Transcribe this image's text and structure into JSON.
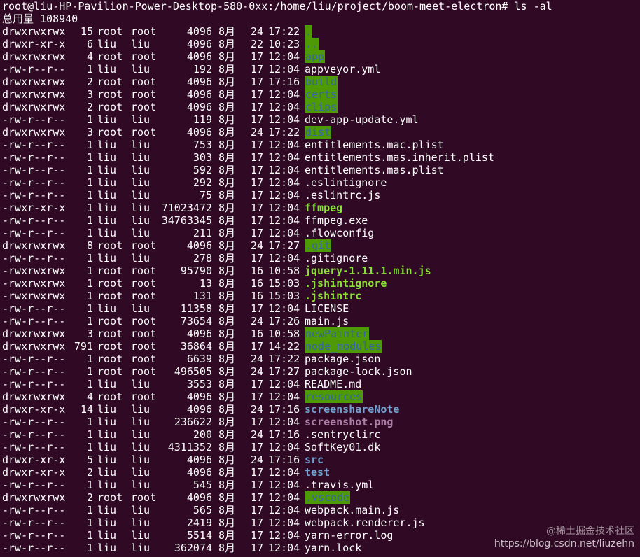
{
  "terminal": {
    "prompt": "root@liu-HP-Pavilion-Power-Desktop-580-0xx:/home/liu/project/boom-meet-electron# ls -al",
    "total": "总用量 108940",
    "rows": [
      [
        "drwxrwxrwx",
        "15",
        "root",
        "root",
        "4096",
        "8月",
        "24",
        "17:22",
        ".",
        "dirbg"
      ],
      [
        "drwxr-xr-x",
        "6",
        "liu",
        "liu",
        "4096",
        "8月",
        "22",
        "10:23",
        "..",
        "dirbg"
      ],
      [
        "drwxrwxrwx",
        "4",
        "root",
        "root",
        "4096",
        "8月",
        "17",
        "12:04",
        "app",
        "dirbg"
      ],
      [
        "-rw-r--r--",
        "1",
        "liu",
        "liu",
        "192",
        "8月",
        "17",
        "12:04",
        "appveyor.yml",
        "file"
      ],
      [
        "drwxrwxrwx",
        "2",
        "root",
        "root",
        "4096",
        "8月",
        "17",
        "17:16",
        "build",
        "dirbg"
      ],
      [
        "drwxrwxrwx",
        "3",
        "root",
        "root",
        "4096",
        "8月",
        "17",
        "12:04",
        "certs",
        "dirbg"
      ],
      [
        "drwxrwxrwx",
        "2",
        "root",
        "root",
        "4096",
        "8月",
        "17",
        "12:04",
        "clips",
        "dirbg"
      ],
      [
        "-rw-r--r--",
        "1",
        "liu",
        "liu",
        "119",
        "8月",
        "17",
        "12:04",
        "dev-app-update.yml",
        "file"
      ],
      [
        "drwxrwxrwx",
        "3",
        "root",
        "root",
        "4096",
        "8月",
        "24",
        "17:22",
        "dist",
        "dirbg"
      ],
      [
        "-rw-r--r--",
        "1",
        "liu",
        "liu",
        "753",
        "8月",
        "17",
        "12:04",
        "entitlements.mac.plist",
        "file"
      ],
      [
        "-rw-r--r--",
        "1",
        "liu",
        "liu",
        "303",
        "8月",
        "17",
        "12:04",
        "entitlements.mas.inherit.plist",
        "file"
      ],
      [
        "-rw-r--r--",
        "1",
        "liu",
        "liu",
        "592",
        "8月",
        "17",
        "12:04",
        "entitlements.mas.plist",
        "file"
      ],
      [
        "-rw-r--r--",
        "1",
        "liu",
        "liu",
        "292",
        "8月",
        "17",
        "12:04",
        ".eslintignore",
        "file"
      ],
      [
        "-rw-r--r--",
        "1",
        "liu",
        "liu",
        "75",
        "8月",
        "17",
        "12:04",
        ".eslintrc.js",
        "file"
      ],
      [
        "-rwxr-xr-x",
        "1",
        "liu",
        "liu",
        "71023472",
        "8月",
        "17",
        "12:04",
        "ffmpeg",
        "exec"
      ],
      [
        "-rw-r--r--",
        "1",
        "liu",
        "liu",
        "34763345",
        "8月",
        "17",
        "12:04",
        "ffmpeg.exe",
        "file"
      ],
      [
        "-rw-r--r--",
        "1",
        "liu",
        "liu",
        "211",
        "8月",
        "17",
        "12:04",
        ".flowconfig",
        "file"
      ],
      [
        "drwxrwxrwx",
        "8",
        "root",
        "root",
        "4096",
        "8月",
        "24",
        "17:27",
        ".git",
        "dirbg"
      ],
      [
        "-rw-r--r--",
        "1",
        "liu",
        "liu",
        "278",
        "8月",
        "17",
        "12:04",
        ".gitignore",
        "file"
      ],
      [
        "-rwxrwxrwx",
        "1",
        "root",
        "root",
        "95790",
        "8月",
        "16",
        "10:58",
        "jquery-1.11.1.min.js",
        "exec"
      ],
      [
        "-rwxrwxrwx",
        "1",
        "root",
        "root",
        "13",
        "8月",
        "16",
        "15:03",
        ".jshintignore",
        "exec"
      ],
      [
        "-rwxrwxrwx",
        "1",
        "root",
        "root",
        "131",
        "8月",
        "16",
        "15:03",
        ".jshintrc",
        "exec"
      ],
      [
        "-rw-r--r--",
        "1",
        "liu",
        "liu",
        "11358",
        "8月",
        "17",
        "12:04",
        "LICENSE",
        "file"
      ],
      [
        "-rw-r--r--",
        "1",
        "root",
        "root",
        "73654",
        "8月",
        "24",
        "17:26",
        "main.js",
        "file"
      ],
      [
        "drwxrwxrwx",
        "3",
        "root",
        "root",
        "4096",
        "8月",
        "16",
        "10:58",
        "newPainter",
        "dirbg"
      ],
      [
        "drwxrwxrwx",
        "791",
        "root",
        "root",
        "36864",
        "8月",
        "17",
        "14:22",
        "node_modules",
        "dirbg"
      ],
      [
        "-rw-r--r--",
        "1",
        "root",
        "root",
        "6639",
        "8月",
        "24",
        "17:22",
        "package.json",
        "file"
      ],
      [
        "-rw-r--r--",
        "1",
        "root",
        "root",
        "496505",
        "8月",
        "24",
        "17:27",
        "package-lock.json",
        "file"
      ],
      [
        "-rw-r--r--",
        "1",
        "liu",
        "liu",
        "3553",
        "8月",
        "17",
        "12:04",
        "README.md",
        "file"
      ],
      [
        "drwxrwxrwx",
        "4",
        "root",
        "root",
        "4096",
        "8月",
        "17",
        "12:04",
        "resources",
        "dirbg"
      ],
      [
        "drwxr-xr-x",
        "14",
        "liu",
        "liu",
        "4096",
        "8月",
        "24",
        "17:16",
        "screenshareNote",
        "dir"
      ],
      [
        "-rw-r--r--",
        "1",
        "liu",
        "liu",
        "236622",
        "8月",
        "17",
        "12:04",
        "screenshot.png",
        "image"
      ],
      [
        "-rw-r--r--",
        "1",
        "liu",
        "liu",
        "200",
        "8月",
        "24",
        "17:16",
        ".sentryclirc",
        "file"
      ],
      [
        "-rw-r--r--",
        "1",
        "liu",
        "liu",
        "4311352",
        "8月",
        "17",
        "12:04",
        "SoftKey01.dk",
        "file"
      ],
      [
        "drwxr-xr-x",
        "5",
        "liu",
        "liu",
        "4096",
        "8月",
        "24",
        "17:16",
        "src",
        "dir"
      ],
      [
        "drwxr-xr-x",
        "2",
        "liu",
        "liu",
        "4096",
        "8月",
        "17",
        "12:04",
        "test",
        "dir"
      ],
      [
        "-rw-r--r--",
        "1",
        "liu",
        "liu",
        "545",
        "8月",
        "17",
        "12:04",
        ".travis.yml",
        "file"
      ],
      [
        "drwxrwxrwx",
        "2",
        "root",
        "root",
        "4096",
        "8月",
        "17",
        "12:04",
        ".vscode",
        "dirbg"
      ],
      [
        "-rw-r--r--",
        "1",
        "liu",
        "liu",
        "565",
        "8月",
        "17",
        "12:04",
        "webpack.main.js",
        "file"
      ],
      [
        "-rw-r--r--",
        "1",
        "liu",
        "liu",
        "2419",
        "8月",
        "17",
        "12:04",
        "webpack.renderer.js",
        "file"
      ],
      [
        "-rw-r--r--",
        "1",
        "liu",
        "liu",
        "5514",
        "8月",
        "17",
        "12:04",
        "yarn-error.log",
        "file"
      ],
      [
        "-rw-r--r--",
        "1",
        "liu",
        "liu",
        "362074",
        "8月",
        "17",
        "12:04",
        "yarn.lock",
        "file"
      ]
    ]
  },
  "watermark": {
    "line1": "@稀土掘金技术社区",
    "line2": "https://blog.csdn.net/liuzehn"
  },
  "colors": {
    "background": "#300a24",
    "dir_highlight_bg": "#4e9a06",
    "dir_highlight_fg": "#3465a4",
    "dir": "#729fcf",
    "exec": "#8ae234",
    "image": "#ad7fa8"
  }
}
